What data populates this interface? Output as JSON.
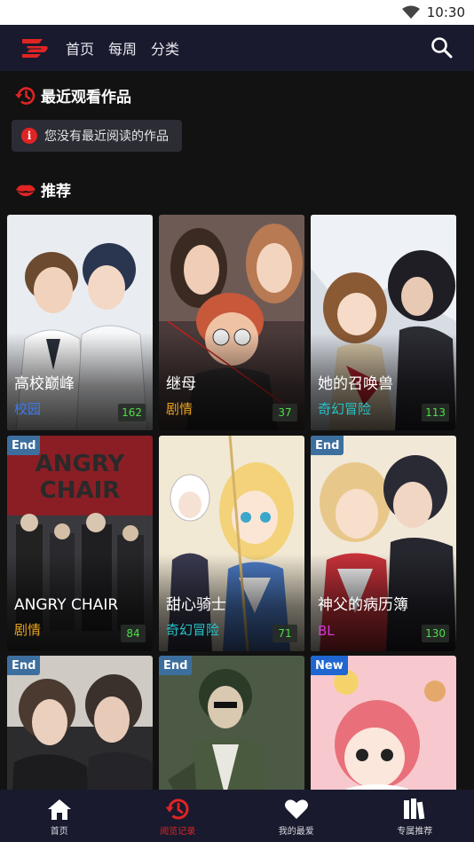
{
  "status_bar": {
    "time": "10:30",
    "wifi_icon": "wifi-icon"
  },
  "top_nav": {
    "logo_icon": "brand-logo-icon",
    "links": [
      {
        "label": "首页"
      },
      {
        "label": "每周"
      },
      {
        "label": "分类"
      }
    ],
    "search_icon": "search-icon"
  },
  "recent": {
    "title": "最近观看作品",
    "icon": "history-icon",
    "empty_message": "您没有最近阅读的作品",
    "empty_icon_glyph": "i"
  },
  "recommend": {
    "title": "推荐",
    "icon": "lips-icon"
  },
  "colors": {
    "accent": "#e02424",
    "count_text": "#4ddf4a",
    "nav_bg": "#191a2e"
  },
  "cards": [
    {
      "title": "高校巅峰",
      "genre": "校园",
      "genre_color": "#3b7bf0",
      "count": "162",
      "badge": ""
    },
    {
      "title": "继母",
      "genre": "剧情",
      "genre_color": "#e8a21c",
      "count": "37",
      "badge": ""
    },
    {
      "title": "她的召唤兽",
      "genre": "奇幻冒险",
      "genre_color": "#27c2c7",
      "count": "113",
      "badge": ""
    },
    {
      "title": "ANGRY CHAIR",
      "genre": "剧情",
      "genre_color": "#e8a21c",
      "count": "84",
      "badge": "End"
    },
    {
      "title": "甜心骑士",
      "genre": "奇幻冒险",
      "genre_color": "#27c2c7",
      "count": "71",
      "badge": ""
    },
    {
      "title": "神父的病历簿",
      "genre": "BL",
      "genre_color": "#d63ad6",
      "count": "130",
      "badge": "End"
    },
    {
      "title": "",
      "genre": "",
      "genre_color": "#ffffff",
      "count": "",
      "badge": "End"
    },
    {
      "title": "",
      "genre": "",
      "genre_color": "#ffffff",
      "count": "",
      "badge": "End"
    },
    {
      "title": "",
      "genre": "",
      "genre_color": "#ffffff",
      "count": "",
      "badge": "New"
    }
  ],
  "tab_bar": [
    {
      "label": "首页",
      "icon": "home-icon",
      "active": false
    },
    {
      "label": "阅览记录",
      "icon": "history-icon",
      "active": true
    },
    {
      "label": "我的最爱",
      "icon": "heart-icon",
      "active": false
    },
    {
      "label": "专属推荐",
      "icon": "books-icon",
      "active": false
    }
  ]
}
